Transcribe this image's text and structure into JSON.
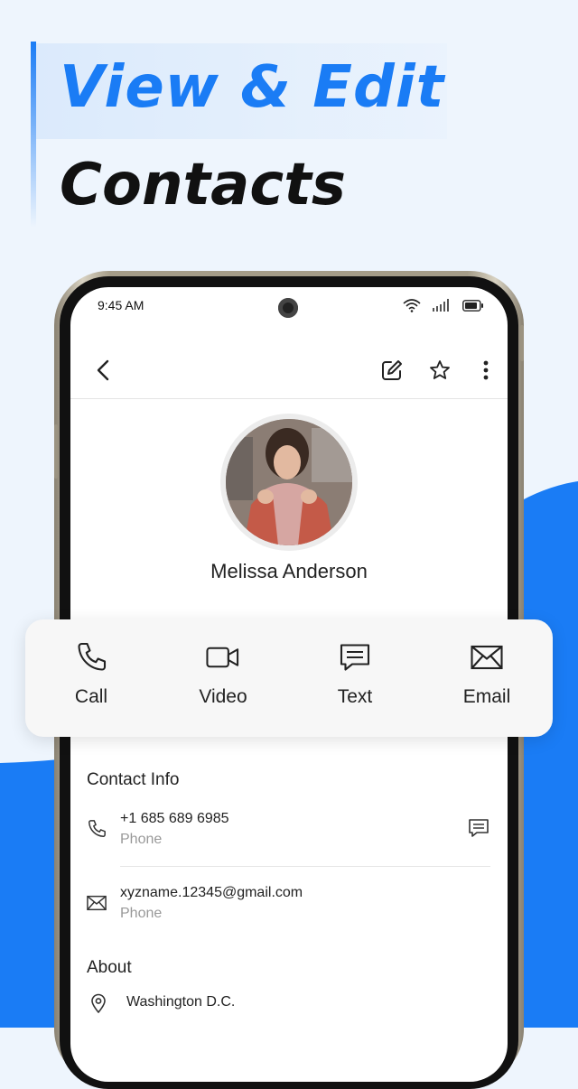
{
  "headline": {
    "line1": "View & Edit",
    "line2": "Contacts"
  },
  "status_bar": {
    "time": "9:45 AM"
  },
  "contact": {
    "name": "Melissa Anderson"
  },
  "actions": {
    "call": "Call",
    "video": "Video",
    "text": "Text",
    "email": "Email"
  },
  "contact_info": {
    "title": "Contact Info",
    "phone": {
      "value": "+1 685 689 6985",
      "label": "Phone"
    },
    "email": {
      "value": "xyzname.12345@gmail.com",
      "label": "Phone"
    }
  },
  "about": {
    "title": "About",
    "location": "Washington D.C."
  },
  "colors": {
    "accent": "#1a7cf5",
    "background": "#eef5fd"
  },
  "icons": [
    "back-icon",
    "edit-icon",
    "star-icon",
    "more-icon",
    "phone-icon",
    "video-icon",
    "message-icon",
    "mail-icon",
    "location-icon"
  ]
}
